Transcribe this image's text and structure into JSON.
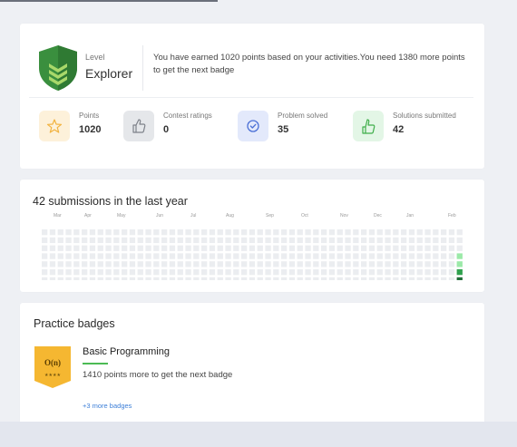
{
  "level": {
    "label": "Level",
    "name": "Explorer",
    "description": "You have earned 1020 points based on your activities.You need 1380 more points to get the next badge",
    "shield_color": "#3a8f3e",
    "shield_icon": "rank-chevrons-shield"
  },
  "stats": [
    {
      "label": "Points",
      "value": "1020",
      "icon": "star-icon",
      "color": "#f2b340"
    },
    {
      "label": "Contest ratings",
      "value": "0",
      "icon": "thumbs-up-icon",
      "color": "#8a8e96"
    },
    {
      "label": "Problem solved",
      "value": "35",
      "icon": "check-circle-icon",
      "color": "#4a6fd6"
    },
    {
      "label": "Solutions submitted",
      "value": "42",
      "icon": "thumbs-up-icon",
      "color": "#3fae4a"
    }
  ],
  "activity": {
    "title": "42 submissions in the last year",
    "months": [
      "Mar",
      "Apr",
      "May",
      "Jun",
      "Jul",
      "Aug",
      "Sep",
      "Oct",
      "Nov",
      "Dec",
      "Jan",
      "Feb"
    ],
    "weeks": 53,
    "days_per_week": 7,
    "empty_color": "#ebedf0",
    "active_cells": [
      {
        "week": 52,
        "day": 3,
        "level": 1
      },
      {
        "week": 52,
        "day": 4,
        "level": 1
      },
      {
        "week": 52,
        "day": 5,
        "level": 3
      },
      {
        "week": 52,
        "day": 6,
        "level": 4
      }
    ],
    "level_colors": [
      "#ebedf0",
      "#9be9a8",
      "#40c463",
      "#30a14e",
      "#216e39"
    ]
  },
  "badges": {
    "title": "Practice badges",
    "items": [
      {
        "icon_text": "O(n)",
        "stars": "★★★★",
        "name": "Basic Programming",
        "description": "1410 points more to get the next badge",
        "color": "#f5b731"
      }
    ],
    "more_link": "+3 more badges"
  }
}
